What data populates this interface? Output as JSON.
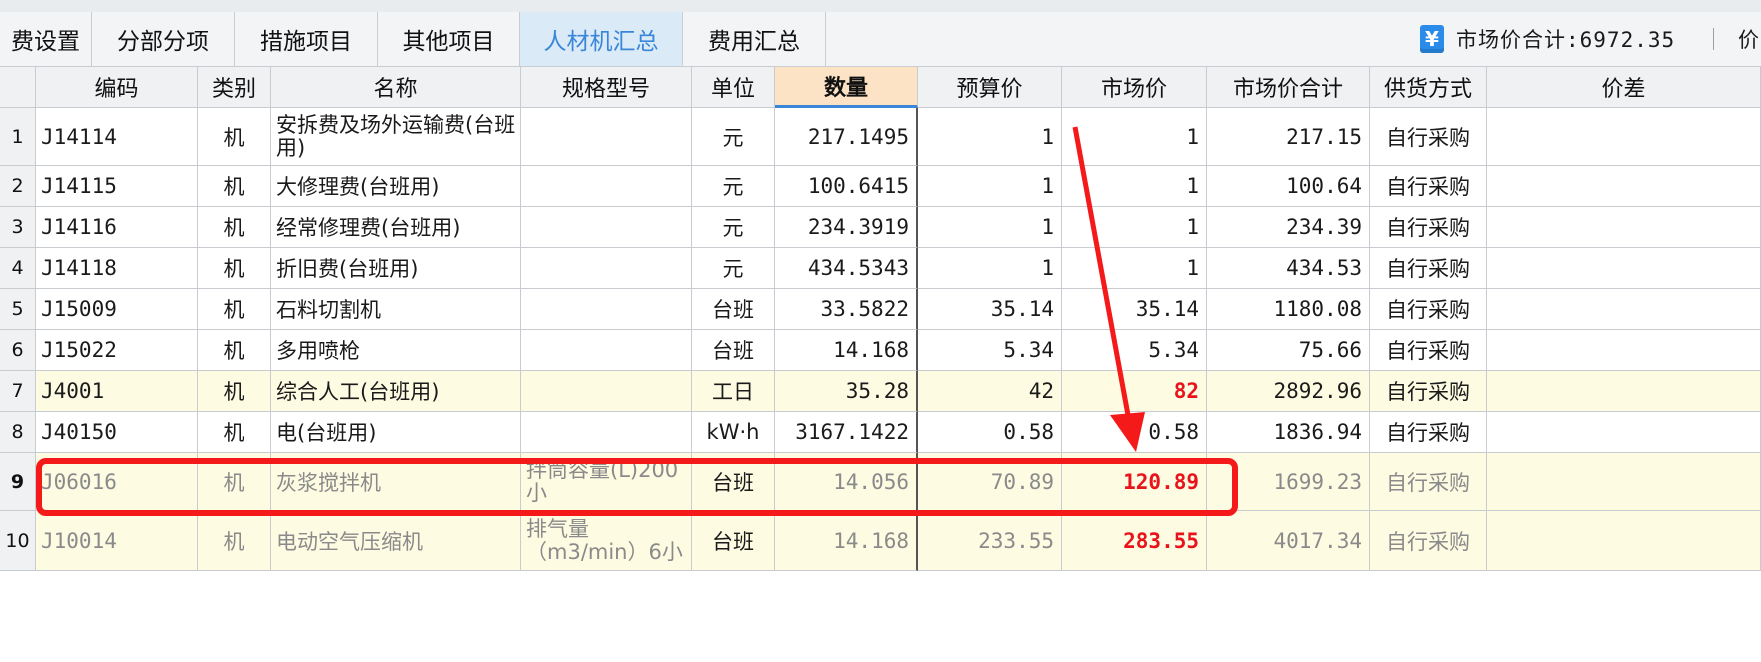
{
  "tabs": [
    {
      "label": "费设置"
    },
    {
      "label": "分部分项"
    },
    {
      "label": "措施项目"
    },
    {
      "label": "其他项目"
    },
    {
      "label": "人材机汇总"
    },
    {
      "label": "费用汇总"
    }
  ],
  "market_total": {
    "icon": "yen-icon",
    "label": "市场价合计:6972.35",
    "truncated_next": "价"
  },
  "columns": [
    "编码",
    "类别",
    "名称",
    "规格型号",
    "单位",
    "数量",
    "预算价",
    "市场价",
    "市场价合计",
    "供货方式",
    "价差"
  ],
  "rows": [
    {
      "idx": "1",
      "code": "J14114",
      "type": "机",
      "name": "安拆费及场外运输费(台班用)",
      "spec": "",
      "unit": "元",
      "qty": "217.1495",
      "budget": "1",
      "market": "1",
      "total": "217.15",
      "supply": "自行采购"
    },
    {
      "idx": "2",
      "code": "J14115",
      "type": "机",
      "name": "大修理费(台班用)",
      "spec": "",
      "unit": "元",
      "qty": "100.6415",
      "budget": "1",
      "market": "1",
      "total": "100.64",
      "supply": "自行采购"
    },
    {
      "idx": "3",
      "code": "J14116",
      "type": "机",
      "name": "经常修理费(台班用)",
      "spec": "",
      "unit": "元",
      "qty": "234.3919",
      "budget": "1",
      "market": "1",
      "total": "234.39",
      "supply": "自行采购"
    },
    {
      "idx": "4",
      "code": "J14118",
      "type": "机",
      "name": "折旧费(台班用)",
      "spec": "",
      "unit": "元",
      "qty": "434.5343",
      "budget": "1",
      "market": "1",
      "total": "434.53",
      "supply": "自行采购"
    },
    {
      "idx": "5",
      "code": "J15009",
      "type": "机",
      "name": "石料切割机",
      "spec": "",
      "unit": "台班",
      "qty": "33.5822",
      "budget": "35.14",
      "market": "35.14",
      "total": "1180.08",
      "supply": "自行采购"
    },
    {
      "idx": "6",
      "code": "J15022",
      "type": "机",
      "name": "多用喷枪",
      "spec": "",
      "unit": "台班",
      "qty": "14.168",
      "budget": "5.34",
      "market": "5.34",
      "total": "75.66",
      "supply": "自行采购"
    },
    {
      "idx": "7",
      "code": "J4001",
      "type": "机",
      "name": "综合人工(台班用)",
      "spec": "",
      "unit": "工日",
      "qty": "35.28",
      "budget": "42",
      "market": "82",
      "total": "2892.96",
      "supply": "自行采购"
    },
    {
      "idx": "8",
      "code": "J40150",
      "type": "机",
      "name": "电(台班用)",
      "spec": "",
      "unit": "kW·h",
      "qty": "3167.1422",
      "budget": "0.58",
      "market": "0.58",
      "total": "1836.94",
      "supply": "自行采购"
    },
    {
      "idx": "9",
      "code": "J06016",
      "type": "机",
      "name": "灰浆搅拌机",
      "spec": "拌筒容量(L)200小",
      "unit": "台班",
      "qty": "14.056",
      "budget": "70.89",
      "market": "120.89",
      "total": "1699.23",
      "supply": "自行采购"
    },
    {
      "idx": "10",
      "code": "J10014",
      "type": "机",
      "name": "电动空气压缩机",
      "spec": "排气量（m3/min）6小",
      "unit": "台班",
      "qty": "14.168",
      "budget": "233.55",
      "market": "283.55",
      "total": "4017.34",
      "supply": "自行采购"
    }
  ],
  "colors": {
    "accent": "#3a86d8",
    "highlight_row": "#fdfbe2",
    "annotation": "#f41a1a",
    "changed_price": "#e8131b"
  }
}
